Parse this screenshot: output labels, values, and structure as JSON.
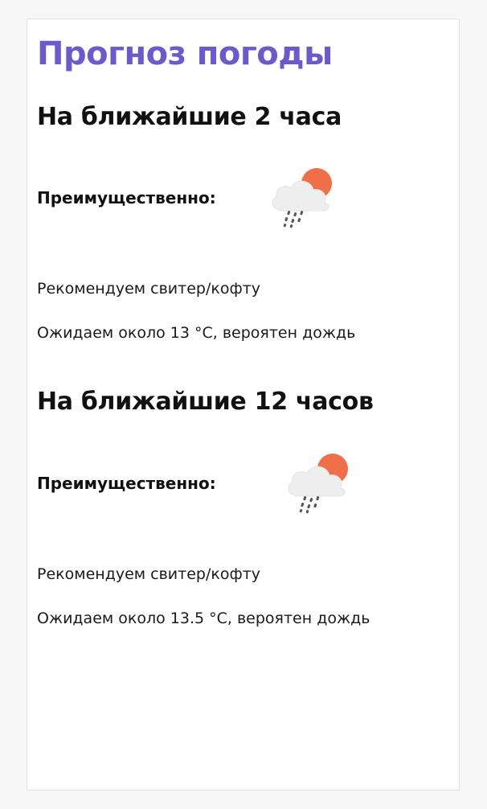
{
  "page": {
    "title": "Прогноз погоды",
    "title_color": "#6a5acd"
  },
  "forecasts": [
    {
      "heading": "На ближайшие 2 часа",
      "mostly_label": "Преимущественно:",
      "icon": "cloud-sun-rain-icon",
      "recommendation": "Рекомендуем свитер/кофту",
      "expectation": "Ожидаем около 13 °C, вероятен дождь"
    },
    {
      "heading": "На ближайшие 12 часов",
      "mostly_label": "Преимущественно:",
      "icon": "cloud-sun-rain-icon",
      "recommendation": "Рекомендуем свитер/кофту",
      "expectation": "Ожидаем около 13.5 °C, вероятен дождь"
    }
  ],
  "colors": {
    "sun": "#ef6f48",
    "cloud": "#eeeeee",
    "rain": "#555555"
  }
}
